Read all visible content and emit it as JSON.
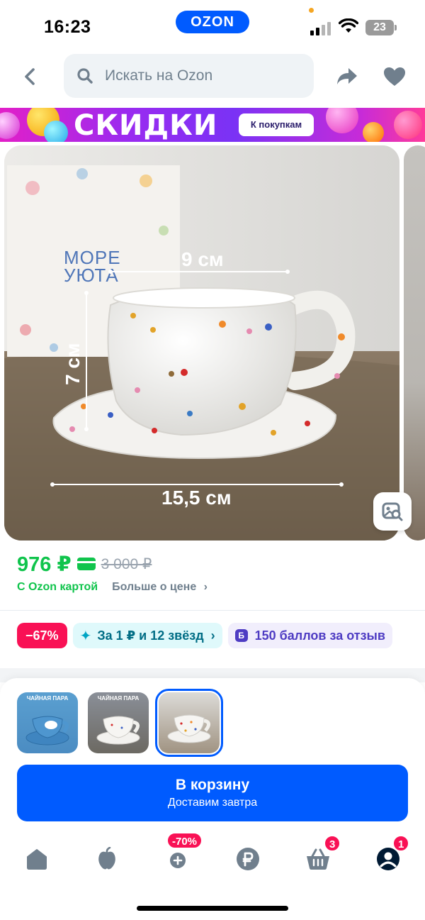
{
  "status_bar": {
    "time": "16:23",
    "ozon_pill": "OZON",
    "battery": "23"
  },
  "header": {
    "search_placeholder": "Искать на Ozon"
  },
  "banner": {
    "title": "СКИДКИ",
    "button": "К покупкам"
  },
  "gallery": {
    "brand_line1": "МОРЕ",
    "brand_line2": "УЮТА",
    "dim_width": "9 см",
    "dim_height": "7 см",
    "dim_saucer": "15,5 см"
  },
  "price": {
    "current": "976 ₽",
    "old": "3 000 ₽",
    "ozon_card_label": "С Ozon картой",
    "more_label": "Больше о цене"
  },
  "chips": {
    "discount": "−67%",
    "stars": "За 1 ₽ и 12 звёзд",
    "points_icon": "Б",
    "points": "150 баллов за отзыв"
  },
  "thumbnails": [
    {
      "caption": "ЧАЙНАЯ ПАРА",
      "selected": false
    },
    {
      "caption": "ЧАЙНАЯ ПАРА",
      "selected": false
    },
    {
      "caption": "",
      "selected": true
    }
  ],
  "cart": {
    "title": "В корзину",
    "subtitle": "Доставим завтра"
  },
  "tabbar": {
    "items": [
      {
        "icon": "home-icon",
        "badge": ""
      },
      {
        "icon": "fresh-icon",
        "badge": ""
      },
      {
        "icon": "catalog-icon",
        "badge": "-70%"
      },
      {
        "icon": "finance-icon",
        "badge": ""
      },
      {
        "icon": "cart-icon",
        "badge": "3"
      },
      {
        "icon": "profile-icon",
        "badge": "1"
      }
    ]
  },
  "colors": {
    "brand": "#005bff",
    "price_green": "#10c44c",
    "discount_red": "#f91155",
    "banner_purple": "#9a2bf0"
  }
}
